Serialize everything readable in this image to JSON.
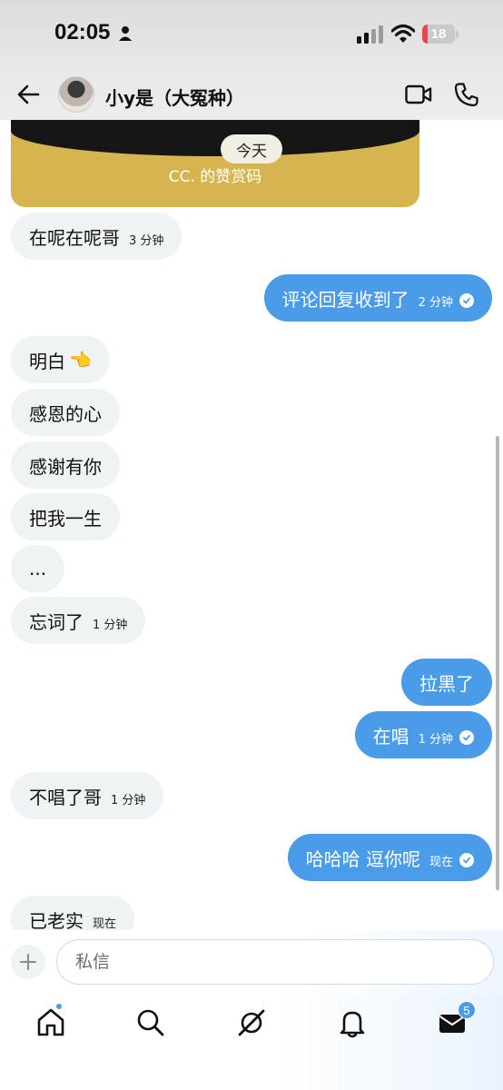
{
  "status_bar": {
    "time": "02:05",
    "battery": "18"
  },
  "header": {
    "title": "小y是（大冤种）"
  },
  "card": {
    "date_label": "今天",
    "caption": "CC. 的赞赏码"
  },
  "messages": [
    {
      "dir": "in",
      "text": "在呢在呢哥",
      "time": "3 分钟"
    },
    {
      "dir": "out",
      "text": "评论回复收到了",
      "time": "2 分钟"
    },
    {
      "dir": "in",
      "text": "明白",
      "emoji": "👈"
    },
    {
      "dir": "in",
      "text": "感恩的心"
    },
    {
      "dir": "in",
      "text": "感谢有你"
    },
    {
      "dir": "in",
      "text": "把我一生"
    },
    {
      "dir": "in",
      "text": "..."
    },
    {
      "dir": "in",
      "text": "忘词了",
      "time": "1 分钟"
    },
    {
      "dir": "out",
      "text": "拉黑了"
    },
    {
      "dir": "out",
      "text": "在唱",
      "time": "1 分钟"
    },
    {
      "dir": "in",
      "text": "不唱了哥",
      "time": "1 分钟"
    },
    {
      "dir": "out",
      "text": "哈哈哈 逗你呢",
      "time": "现在"
    },
    {
      "dir": "in",
      "text": "已老实",
      "time": "现在"
    }
  ],
  "composer": {
    "placeholder": "私信"
  },
  "nav": {
    "messages_badge": "5"
  },
  "colors": {
    "accent": "#4a9be8",
    "incoming_bubble": "#eff3f4",
    "card_gold": "#d6b551"
  }
}
